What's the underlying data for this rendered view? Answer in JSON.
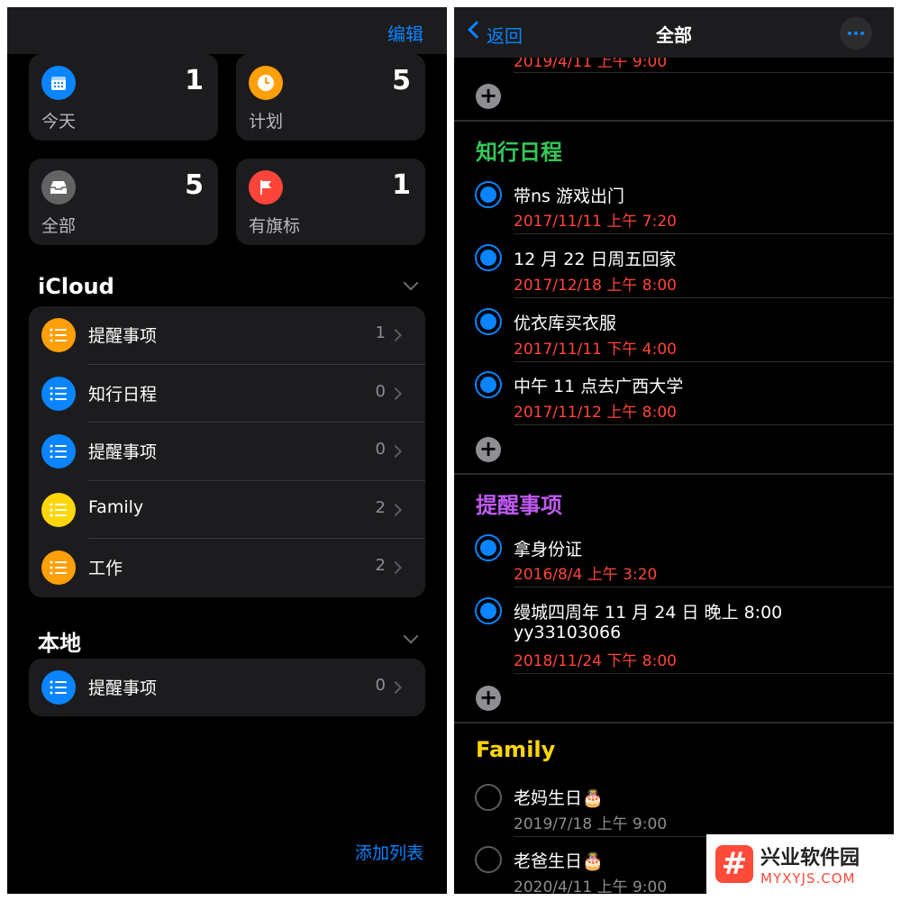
{
  "left": {
    "edit_label": "编辑",
    "smart_lists": [
      {
        "label": "今天",
        "count": "1",
        "icon": "calendar-icon",
        "color": "#0a84ff"
      },
      {
        "label": "计划",
        "count": "5",
        "icon": "clock-icon",
        "color": "#ff9f0a"
      },
      {
        "label": "全部",
        "count": "5",
        "icon": "tray-icon",
        "color": "#636366"
      },
      {
        "label": "有旗标",
        "count": "1",
        "icon": "flag-icon",
        "color": "#ff453a"
      }
    ],
    "icloud_title": "iCloud",
    "icloud_lists": [
      {
        "name": "提醒事项",
        "count": "1",
        "color": "#ff9f0a"
      },
      {
        "name": "知行日程",
        "count": "0",
        "color": "#0a84ff"
      },
      {
        "name": "提醒事项",
        "count": "0",
        "color": "#0a84ff"
      },
      {
        "name": "Family",
        "count": "2",
        "color": "#ffd60a"
      },
      {
        "name": "工作",
        "count": "2",
        "color": "#ff9f0a"
      }
    ],
    "local_title": "本地",
    "local_lists": [
      {
        "name": "提醒事项",
        "count": "0",
        "color": "#0a84ff"
      }
    ],
    "add_list_label": "添加列表"
  },
  "right": {
    "back_label": "返回",
    "title": "全部",
    "peek_date": "2019/4/11 上午 9:00",
    "groups": [
      {
        "title": "知行日程",
        "color": "#34c759",
        "items": [
          {
            "title": "带ns 游戏出门",
            "date": "2017/11/11 上午 7:20"
          },
          {
            "title": "12 月 22 日周五回家",
            "date": "2017/12/18 上午 8:00"
          },
          {
            "title": "优衣库买衣服",
            "date": "2017/11/11 下午 4:00"
          },
          {
            "title": "中午 11 点去广西大学",
            "date": "2017/11/12 上午 8:00"
          }
        ]
      },
      {
        "title": "提醒事项",
        "color": "#bf5af2",
        "items": [
          {
            "title": "拿身份证",
            "date": "2016/8/4 上午 3:20"
          },
          {
            "title": "缦城四周年 11 月 24 日 晚上 8:00",
            "title2": "yy33103066",
            "date": "2018/11/24 下午 8:00"
          }
        ]
      },
      {
        "title": "Family",
        "color": "#ffd60a",
        "items": [
          {
            "title": "老妈生日🎂",
            "date": "2019/7/18 上午 9:00"
          },
          {
            "title": "老爸生日🎂",
            "date": "2020/4/11 上午 9:00"
          }
        ]
      }
    ]
  },
  "watermark": {
    "logo": "#",
    "cn": "兴业软件园",
    "en": "MYXYJS.COM"
  }
}
